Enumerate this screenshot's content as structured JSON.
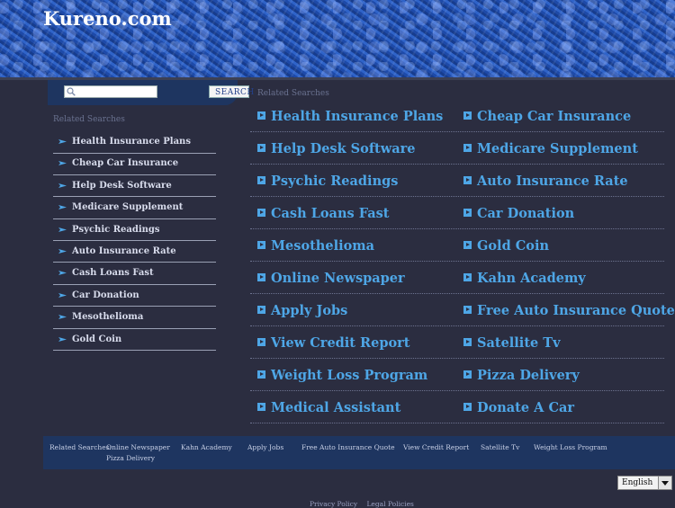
{
  "header": {
    "site_title": "Kureno.com"
  },
  "search": {
    "placeholder": "",
    "button_label": "SEARCH"
  },
  "sidebar": {
    "related_title": "Related Searches",
    "items": [
      "Health Insurance Plans",
      "Cheap Car Insurance",
      "Help Desk Software",
      "Medicare Supplement",
      "Psychic Readings",
      "Auto Insurance Rate",
      "Cash Loans Fast",
      "Car Donation",
      "Mesothelioma",
      "Gold Coin"
    ]
  },
  "main": {
    "related_title": "Related Searches",
    "links": [
      [
        "Health Insurance Plans",
        "Cheap Car Insurance"
      ],
      [
        "Help Desk Software",
        "Medicare Supplement"
      ],
      [
        "Psychic Readings",
        "Auto Insurance Rate"
      ],
      [
        "Cash Loans Fast",
        "Car Donation"
      ],
      [
        "Mesothelioma",
        "Gold Coin"
      ],
      [
        "Online Newspaper",
        "Kahn Academy"
      ],
      [
        "Apply Jobs",
        "Free Auto Insurance Quote"
      ],
      [
        "View Credit Report",
        "Satellite Tv"
      ],
      [
        "Weight Loss Program",
        "Pizza Delivery"
      ],
      [
        "Medical Assistant",
        "Donate A Car"
      ]
    ]
  },
  "footer": {
    "label": "Related Searches:",
    "links": [
      "Online Newspaper",
      "Kahn Academy",
      "Apply Jobs",
      "Free Auto Insurance Quote",
      "View Credit Report",
      "Satellite Tv",
      "Weight Loss Program",
      "Pizza Delivery"
    ]
  },
  "language": {
    "selected": "English"
  },
  "bottom": {
    "privacy": "Privacy Policy",
    "legal": "Legal Policies"
  },
  "colors": {
    "link": "#4ea6e6",
    "background": "#2b2d40",
    "bar": "#1e3560"
  }
}
